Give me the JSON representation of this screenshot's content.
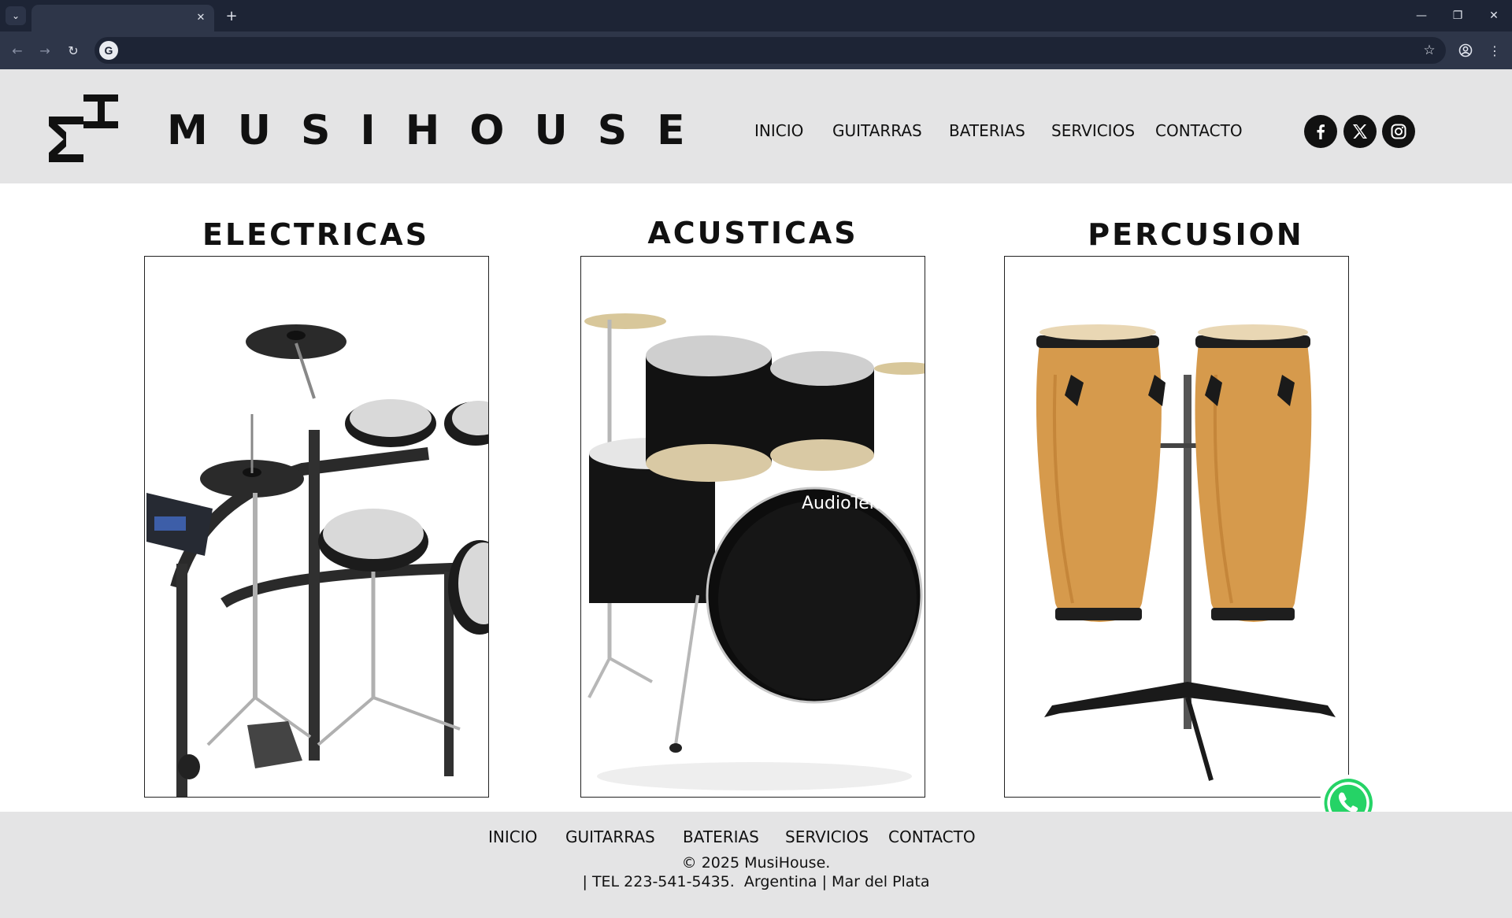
{
  "browser": {
    "tab_title": "",
    "url": "",
    "colors": {
      "frame": "#1d2435",
      "toolbar": "#2e3649"
    }
  },
  "header": {
    "logo_icon": "mh-monogram-icon",
    "brand": "MUSIHOUSE",
    "nav": [
      "INICIO",
      "GUITARRAS",
      "BATERIAS",
      "SERVICIOS",
      "CONTACTO"
    ],
    "socials": [
      "facebook-icon",
      "x-icon",
      "instagram-icon"
    ]
  },
  "categories": [
    {
      "title": "ELECTRICAS",
      "image": "electronic-drum-kit-image"
    },
    {
      "title": "ACUSTICAS",
      "image": "acoustic-drum-kit-image",
      "bass_drum_brand": "AudioTek"
    },
    {
      "title": "PERCUSION",
      "image": "conga-drums-image"
    }
  ],
  "floating": {
    "whatsapp_icon": "whatsapp-icon",
    "color": "#25d366"
  },
  "footer": {
    "nav": [
      "INICIO",
      "GUITARRAS",
      "BATERIAS",
      "SERVICIOS",
      "CONTACTO"
    ],
    "copyright": "© 2025 MusiHouse.",
    "contact": "| TEL 223-541-5435.  Argentina | Mar del Plata"
  },
  "colors": {
    "header_bg": "#e4e4e5",
    "text": "#111111"
  }
}
